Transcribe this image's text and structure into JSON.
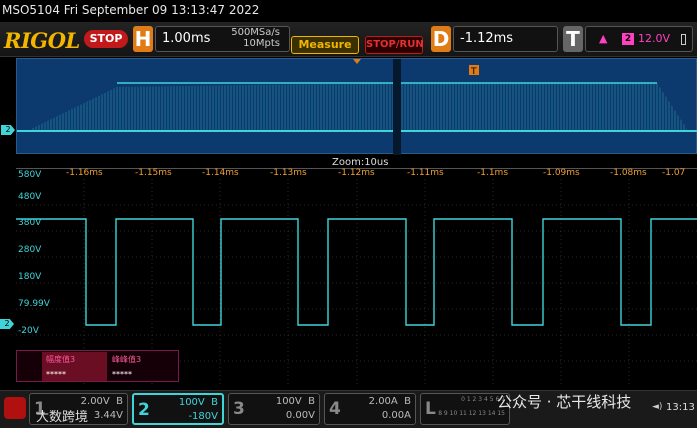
{
  "title": "MSO5104  Fri September 09 13:13:47 2022",
  "toolbar": {
    "brand": "RIGOL",
    "stop_label": "STOP",
    "h_label": "H",
    "timebase": "1.00ms",
    "sample_rate": "500MSa/s",
    "memory_depth": "10Mpts",
    "measure_label": "Measure",
    "stoprun_label": "STOP/RUN",
    "d_label": "D",
    "delay": "-1.12ms",
    "t_label": "T",
    "trigger_edge": "▲",
    "trigger_source": "2",
    "trigger_level": "12.0V",
    "trigger_marker": "T"
  },
  "overview": {
    "zoom_label": "Zoom:10us"
  },
  "grid": {
    "y_labels": [
      "580V",
      "480V",
      "380V",
      "280V",
      "180V",
      "79.99V",
      "-20V"
    ],
    "x_labels": [
      "-1.16ms",
      "-1.15ms",
      "-1.14ms",
      "-1.13ms",
      "-1.12ms",
      "-1.11ms",
      "-1.1ms",
      "-1.09ms",
      "-1.08ms",
      "-1.07"
    ],
    "ch2_marker": "2",
    "trace_color": "#40d4d8",
    "grid_color": "#2a2a2a",
    "axis_text_color": "#f0a030"
  },
  "measure_panel": {
    "m1_label": "幅度值3",
    "m1_value": "*****",
    "m2_label": "峰峰值3",
    "m2_value": "*****"
  },
  "channels": {
    "ch1": {
      "num": "1",
      "scale": "2.00V",
      "coupling": "B",
      "offset": "3.44V"
    },
    "ch2": {
      "num": "2",
      "scale": "100V",
      "coupling": "B",
      "offset": "-180V"
    },
    "ch3": {
      "num": "3",
      "scale": "100V",
      "coupling": "B",
      "offset": "0.00V"
    },
    "ch4": {
      "num": "4",
      "scale": "2.00A",
      "coupling": "B",
      "offset": "0.00A"
    },
    "la": {
      "num": "L",
      "row1": "0 1 2 3 4 5 6 7",
      "row2": "8 9 10 11 12 13 14 15"
    }
  },
  "watermark": {
    "left": "大数跨境",
    "right": "公众号 · 芯干线科技"
  },
  "status": {
    "clock": "13:13",
    "volume": "◄)"
  }
}
